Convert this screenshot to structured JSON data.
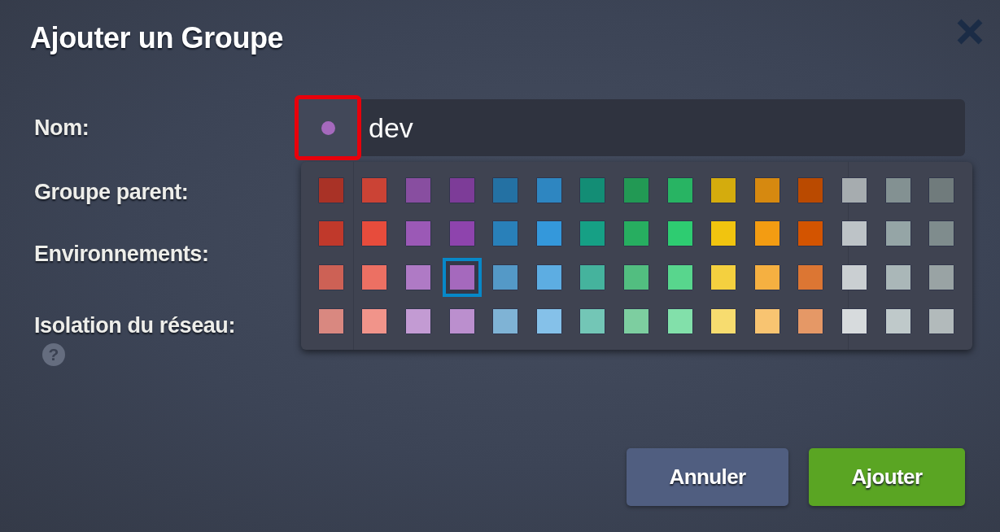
{
  "dialog": {
    "title": "Ajouter un Groupe"
  },
  "name_field": {
    "label": "Nom:",
    "value": "dev",
    "color": "#a569bd",
    "picker_highlighted": true
  },
  "fields": [
    {
      "label": "Groupe parent:"
    },
    {
      "label": "Environnements:"
    },
    {
      "label": "Isolation du réseau:",
      "help": "?"
    }
  ],
  "color_palette": {
    "open": true,
    "rows": [
      {
        "swatches": [
          {
            "color": "#a93226",
            "selected": false
          },
          {
            "color": "#cb4335",
            "selected": false
          },
          {
            "color": "#884ea0",
            "selected": false
          },
          {
            "color": "#7d3c98",
            "selected": false
          },
          {
            "color": "#2471a3",
            "selected": false
          },
          {
            "color": "#2e86c1",
            "selected": false
          },
          {
            "color": "#138d75",
            "selected": false
          },
          {
            "color": "#229954",
            "selected": false
          },
          {
            "color": "#28b463",
            "selected": false
          },
          {
            "color": "#d4ac0d",
            "selected": false
          },
          {
            "color": "#d68910",
            "selected": false
          },
          {
            "color": "#ba4a00",
            "selected": false
          },
          {
            "color": "#a6acaf",
            "selected": false
          },
          {
            "color": "#839192",
            "selected": false
          },
          {
            "color": "#707b7c",
            "selected": false
          }
        ]
      },
      {
        "swatches": [
          {
            "color": "#c0392b",
            "selected": false
          },
          {
            "color": "#e74c3c",
            "selected": false
          },
          {
            "color": "#9b59b6",
            "selected": false
          },
          {
            "color": "#8e44ad",
            "selected": false
          },
          {
            "color": "#2980b9",
            "selected": false
          },
          {
            "color": "#3498db",
            "selected": false
          },
          {
            "color": "#16a085",
            "selected": false
          },
          {
            "color": "#27ae60",
            "selected": false
          },
          {
            "color": "#2ecc71",
            "selected": false
          },
          {
            "color": "#f1c40f",
            "selected": false
          },
          {
            "color": "#f39c12",
            "selected": false
          },
          {
            "color": "#d35400",
            "selected": false
          },
          {
            "color": "#bdc3c7",
            "selected": false
          },
          {
            "color": "#95a5a6",
            "selected": false
          },
          {
            "color": "#7f8c8d",
            "selected": false
          }
        ]
      },
      {
        "swatches": [
          {
            "color": "#cd6155",
            "selected": false
          },
          {
            "color": "#ec7063",
            "selected": false
          },
          {
            "color": "#af7ac5",
            "selected": false
          },
          {
            "color": "#a569bd",
            "selected": true
          },
          {
            "color": "#5499c7",
            "selected": false
          },
          {
            "color": "#5dade2",
            "selected": false
          },
          {
            "color": "#45b39d",
            "selected": false
          },
          {
            "color": "#52be80",
            "selected": false
          },
          {
            "color": "#58d68d",
            "selected": false
          },
          {
            "color": "#f4d03f",
            "selected": false
          },
          {
            "color": "#f5b041",
            "selected": false
          },
          {
            "color": "#dc7633",
            "selected": false
          },
          {
            "color": "#cacfd2",
            "selected": false
          },
          {
            "color": "#aab7b8",
            "selected": false
          },
          {
            "color": "#99a3a4",
            "selected": false
          }
        ]
      },
      {
        "swatches": [
          {
            "color": "#d98880",
            "selected": false
          },
          {
            "color": "#f1948a",
            "selected": false
          },
          {
            "color": "#c39bd3",
            "selected": false
          },
          {
            "color": "#bb8fce",
            "selected": false
          },
          {
            "color": "#7fb3d5",
            "selected": false
          },
          {
            "color": "#85c1e9",
            "selected": false
          },
          {
            "color": "#73c6b6",
            "selected": false
          },
          {
            "color": "#7dcea0",
            "selected": false
          },
          {
            "color": "#82e0aa",
            "selected": false
          },
          {
            "color": "#f7dc6f",
            "selected": false
          },
          {
            "color": "#f8c471",
            "selected": false
          },
          {
            "color": "#e59866",
            "selected": false
          },
          {
            "color": "#d7dbdd",
            "selected": false
          },
          {
            "color": "#bfc9ca",
            "selected": false
          },
          {
            "color": "#b2babb",
            "selected": false
          }
        ]
      }
    ]
  },
  "buttons": [
    {
      "label": "Annuler",
      "kind": "secondary"
    },
    {
      "label": "Ajouter",
      "kind": "primary"
    }
  ]
}
